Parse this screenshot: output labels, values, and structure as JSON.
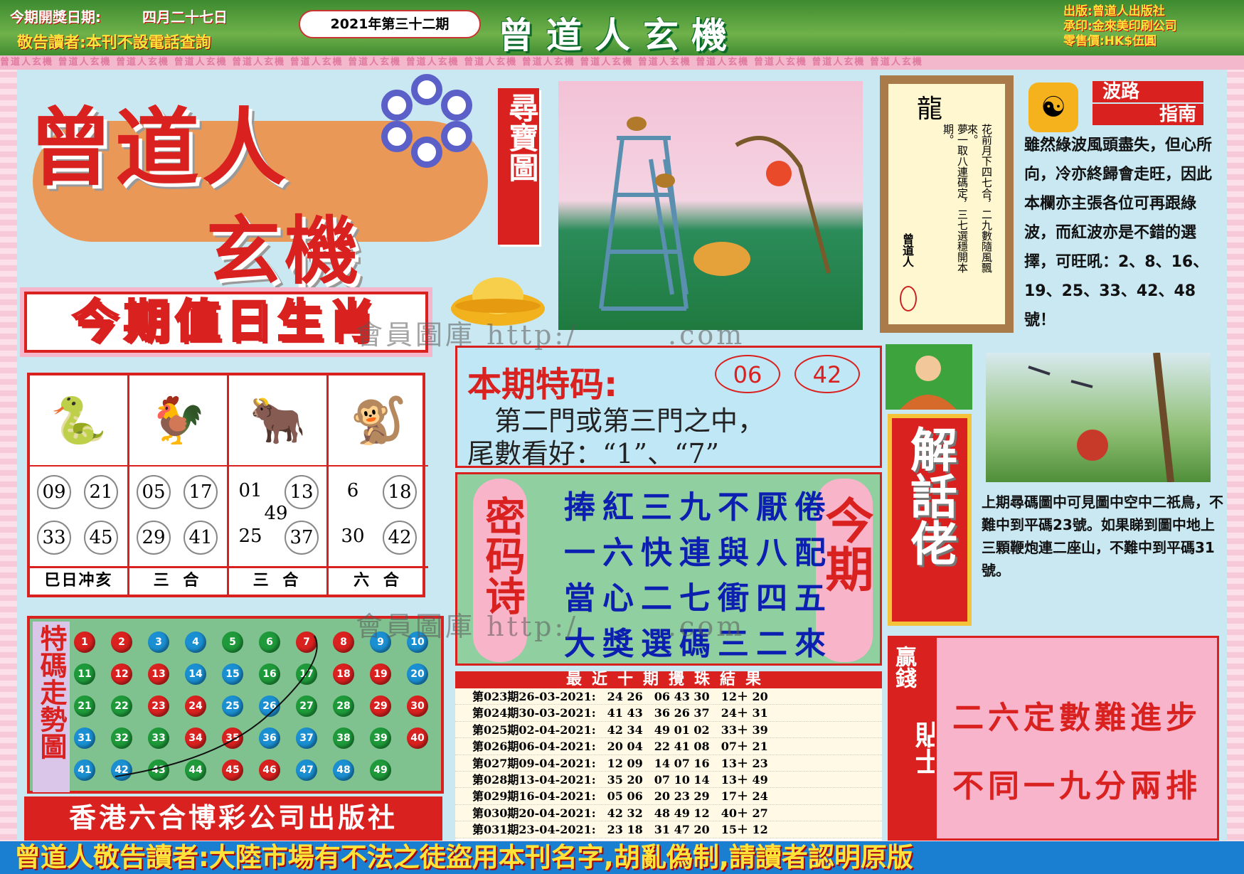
{
  "topbar": {
    "draw_date_label": "今期開獎日期:",
    "draw_date": "四月二十七日",
    "notice": "敬告讀者:本刊不設電話查詢",
    "issue": "2021年第三十二期",
    "title": "曾道人玄機",
    "publisher_line": "出版:曾道人出版社",
    "printer_line": "承印:金來美印刷公司",
    "price_line": "零售價:HK$伍圓"
  },
  "strip_text": "曾道人玄機 曾道人玄機 曾道人玄機 曾道人玄機 曾道人玄機 曾道人玄機 曾道人玄機 曾道人玄機 曾道人玄機 曾道人玄機 曾道人玄機 曾道人玄機 曾道人玄機 曾道人玄機 曾道人玄機 曾道人玄機",
  "brand": {
    "line1": "曾道人",
    "line2": "玄機",
    "treasure_tag": "尋寶圖"
  },
  "scroll": {
    "title": "龍",
    "col1": "花前月下四七合，二九數隨風飄來。",
    "col2": "夢一取八連碼定，三七選穩開本期。",
    "author": "曾道人"
  },
  "wave": {
    "tag1": "波路",
    "tag2": "指南",
    "text": "雖然綠波風頭盡失，但心所向，冷亦終歸會走旺，因此本欄亦主張各位可再跟綠波，而紅波亦是不錯的選擇，可旺吼：2、8、16、19、25、33、42、48號！"
  },
  "zodiac": {
    "title": "今期值日生肖",
    "cols": [
      {
        "icon": "snake",
        "glyph": "🐍",
        "nums": [
          "09",
          "21",
          "33",
          "45"
        ],
        "label": "巳日冲亥"
      },
      {
        "icon": "rooster",
        "glyph": "🐓",
        "nums": [
          "05",
          "17",
          "29",
          "41"
        ],
        "label": "三 合"
      },
      {
        "icon": "ox",
        "glyph": "🐂",
        "nums": [
          "01",
          "13",
          "25",
          "37"
        ],
        "extra": "49",
        "label": "三 合"
      },
      {
        "icon": "monkey",
        "glyph": "🐒",
        "nums": [
          "6",
          "18",
          "30",
          "42"
        ],
        "label": "六 合"
      }
    ]
  },
  "special": {
    "title": "本期特码:",
    "num1": "06",
    "num2": "42",
    "line1": "　第二門或第三門之中，",
    "line2": "尾數看好：“1”、“7”"
  },
  "poem": {
    "tag": "密码诗",
    "tag_right": "今期",
    "lines": [
      "捧紅三九不厭倦",
      "一六快連與八配",
      "當心二七衝四五",
      "大獎選碼三二來"
    ]
  },
  "history": {
    "title": "最近十期攪珠結果",
    "rows": [
      "第023期26-03-2021:　24 26　06 43 30　12＋ 20",
      "第024期30-03-2021:　41 43　36 26 37　24＋ 31",
      "第025期02-04-2021:　42 34　49 01 02　33＋ 39",
      "第026期06-04-2021:　20 04　22 41 08　07＋ 21",
      "第027期09-04-2021:　12 09　14 07 16　13＋ 23",
      "第028期13-04-2021:　35 20　07 10 14　13＋ 49",
      "第029期16-04-2021:　05 06　20 23 29　17＋ 24",
      "第030期20-04-2021:　42 32　48 49 12　40＋ 27",
      "第031期23-04-2021:　23 18　31 47 20　15＋ 12"
    ]
  },
  "trend": {
    "label": "特碼走勢圖",
    "balls": [
      {
        "n": "1",
        "c": "#d9211f"
      },
      {
        "n": "2",
        "c": "#d9211f"
      },
      {
        "n": "3",
        "c": "#1a8fd1"
      },
      {
        "n": "4",
        "c": "#1a8fd1"
      },
      {
        "n": "5",
        "c": "#1e9a3a"
      },
      {
        "n": "6",
        "c": "#1e9a3a"
      },
      {
        "n": "7",
        "c": "#d9211f"
      },
      {
        "n": "8",
        "c": "#d9211f"
      },
      {
        "n": "9",
        "c": "#1a8fd1"
      },
      {
        "n": "10",
        "c": "#1a8fd1"
      },
      {
        "n": "11",
        "c": "#1e9a3a"
      },
      {
        "n": "12",
        "c": "#d9211f"
      },
      {
        "n": "13",
        "c": "#d9211f"
      },
      {
        "n": "14",
        "c": "#1a8fd1"
      },
      {
        "n": "15",
        "c": "#1a8fd1"
      },
      {
        "n": "16",
        "c": "#1e9a3a"
      },
      {
        "n": "17",
        "c": "#1e9a3a"
      },
      {
        "n": "18",
        "c": "#d9211f"
      },
      {
        "n": "19",
        "c": "#d9211f"
      },
      {
        "n": "20",
        "c": "#1a8fd1"
      },
      {
        "n": "21",
        "c": "#1e9a3a"
      },
      {
        "n": "22",
        "c": "#1e9a3a"
      },
      {
        "n": "23",
        "c": "#d9211f"
      },
      {
        "n": "24",
        "c": "#d9211f"
      },
      {
        "n": "25",
        "c": "#1a8fd1"
      },
      {
        "n": "26",
        "c": "#1a8fd1"
      },
      {
        "n": "27",
        "c": "#1e9a3a"
      },
      {
        "n": "28",
        "c": "#1e9a3a"
      },
      {
        "n": "29",
        "c": "#d9211f"
      },
      {
        "n": "30",
        "c": "#d9211f"
      },
      {
        "n": "31",
        "c": "#1a8fd1"
      },
      {
        "n": "32",
        "c": "#1e9a3a"
      },
      {
        "n": "33",
        "c": "#1e9a3a"
      },
      {
        "n": "34",
        "c": "#d9211f"
      },
      {
        "n": "35",
        "c": "#d9211f"
      },
      {
        "n": "36",
        "c": "#1a8fd1"
      },
      {
        "n": "37",
        "c": "#1a8fd1"
      },
      {
        "n": "38",
        "c": "#1e9a3a"
      },
      {
        "n": "39",
        "c": "#1e9a3a"
      },
      {
        "n": "40",
        "c": "#d9211f"
      },
      {
        "n": "41",
        "c": "#1a8fd1"
      },
      {
        "n": "42",
        "c": "#1a8fd1"
      },
      {
        "n": "43",
        "c": "#1e9a3a"
      },
      {
        "n": "44",
        "c": "#1e9a3a"
      },
      {
        "n": "45",
        "c": "#d9211f"
      },
      {
        "n": "46",
        "c": "#d9211f"
      },
      {
        "n": "47",
        "c": "#1a8fd1"
      },
      {
        "n": "48",
        "c": "#1a8fd1"
      },
      {
        "n": "49",
        "c": "#1e9a3a"
      }
    ]
  },
  "publisher": "香港六合博彩公司出版社",
  "explain": {
    "tag": "解話佬",
    "text": "上期尋碼圖中可見圖中空中二祇鳥，不難中到平碼23號。如果睇到圖中地上三顆鞭炮連二座山，不難中到平碼31號。"
  },
  "tips": {
    "tag1": "贏錢",
    "tag2": "貼士",
    "line1": "二六定數難進步",
    "line2": "不同一九分兩排"
  },
  "watermark": "會員圖庫 http:/　　　.com",
  "footer": "曾道人敬告讀者:大陸市場有不法之徒盜用本刊名字,胡亂偽制,請讀者認明原版"
}
